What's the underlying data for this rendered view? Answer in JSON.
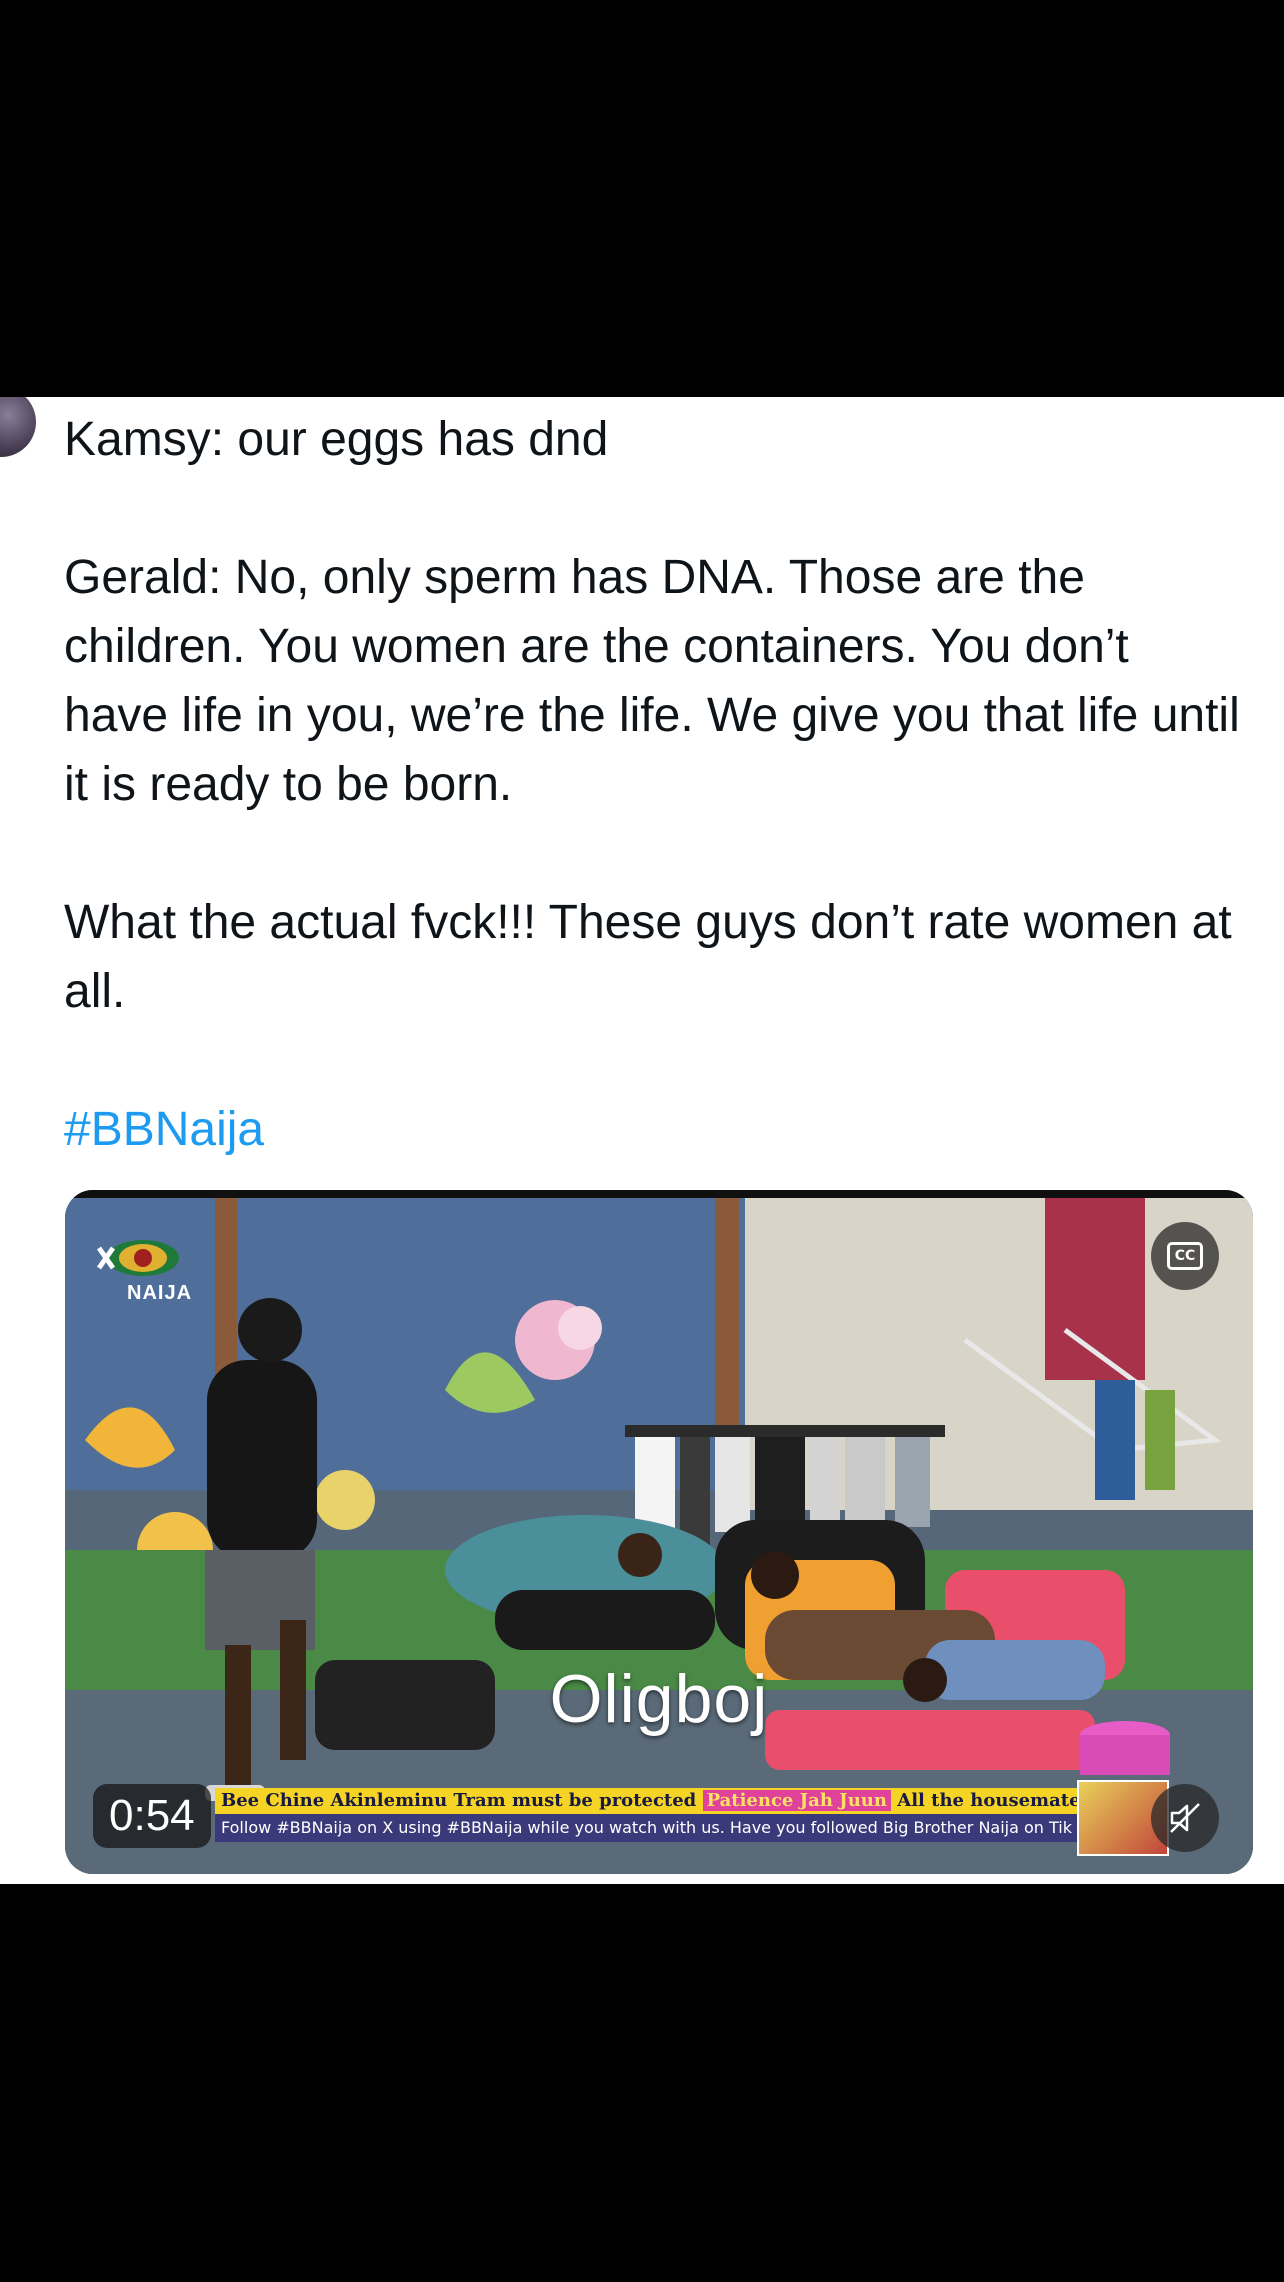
{
  "tweet": {
    "paragraphs": [
      "Kamsy: our eggs has dnd",
      "Gerald: No, only sperm has DNA. Those are the children. You women are the containers. You don’t have life in you, we’re the life. We give you that life until it is ready to be born.",
      "What the actual fvck!!! These guys don’t rate women at all."
    ],
    "hashtag": "#BBNaija"
  },
  "video": {
    "logo_text": "NAIJA",
    "subtitle": "Oligboj",
    "ticker_top": "Bee Chine Akinleminu  Tram must be protected",
    "ticker_top_highlight": "Patience Jah Juun",
    "ticker_top_end": "All the housemates look",
    "ticker_bottom": "Follow #BBNaija on X using #BBNaija while you watch with us.    Have you followed Big Brother Naija on Tik",
    "duration": "0:54",
    "cc_label": "CC",
    "icons": [
      "cc-icon",
      "muted-speaker-icon"
    ]
  },
  "colors": {
    "hashtag": "#1d9bf0",
    "text": "#0f1419",
    "background": "#ffffff"
  }
}
